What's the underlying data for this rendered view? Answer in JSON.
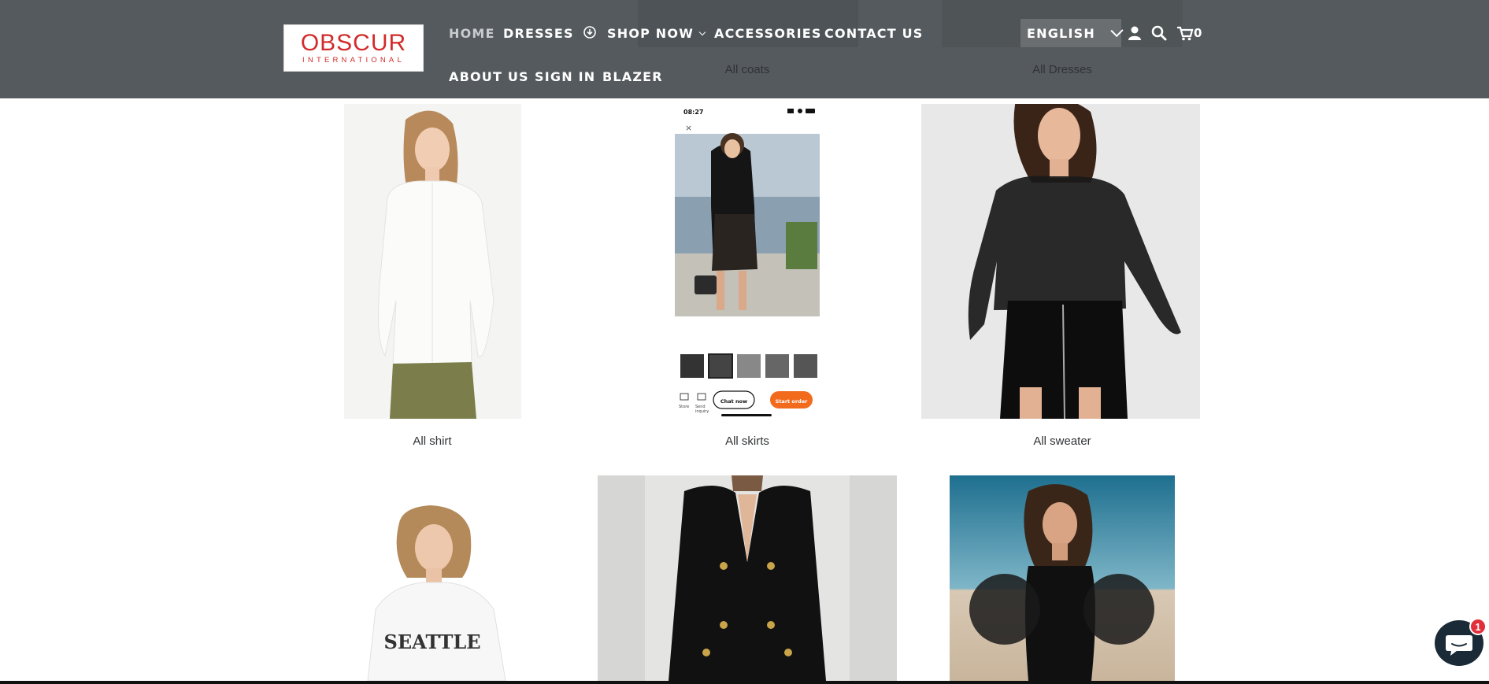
{
  "header": {
    "logo": {
      "main": "OBSCUR",
      "sub": "INTERNATIONAL"
    },
    "nav": [
      {
        "label": "HOME",
        "active": true
      },
      {
        "label": "DRESSES"
      },
      {
        "label": "SHOP NOW"
      },
      {
        "label": "ACCESSORIES"
      },
      {
        "label": "CONTACT US"
      },
      {
        "label": "ABOUT US"
      },
      {
        "label": "SIGN IN"
      },
      {
        "label": "BLAZER"
      }
    ],
    "language": "ENGLISH",
    "cart_count": "0",
    "icons": {
      "shop_now": "download-circle-icon",
      "account": "user-icon",
      "search": "search-icon",
      "cart": "cart-icon",
      "language": "chevron-down-icon"
    }
  },
  "behind_header": {
    "coats_label": "All coats",
    "dresses_label": "All Dresses"
  },
  "collections": [
    {
      "label": "All shirt"
    },
    {
      "label": "All skirts"
    },
    {
      "label": "All sweater"
    }
  ],
  "phone_screenshot": {
    "time": "08:27",
    "chat_label": "Chat now",
    "order_label": "Start order",
    "store_label": "Store",
    "inquiry_label": "Send inquiry"
  },
  "tshirt_print": "SEATTLE",
  "chat_widget": {
    "badge": "1"
  },
  "colors": {
    "header_bg": "#505559",
    "accent_orange": "#f26b1d",
    "logo_red": "#d22b2b",
    "badge_red": "#e22d3b"
  }
}
